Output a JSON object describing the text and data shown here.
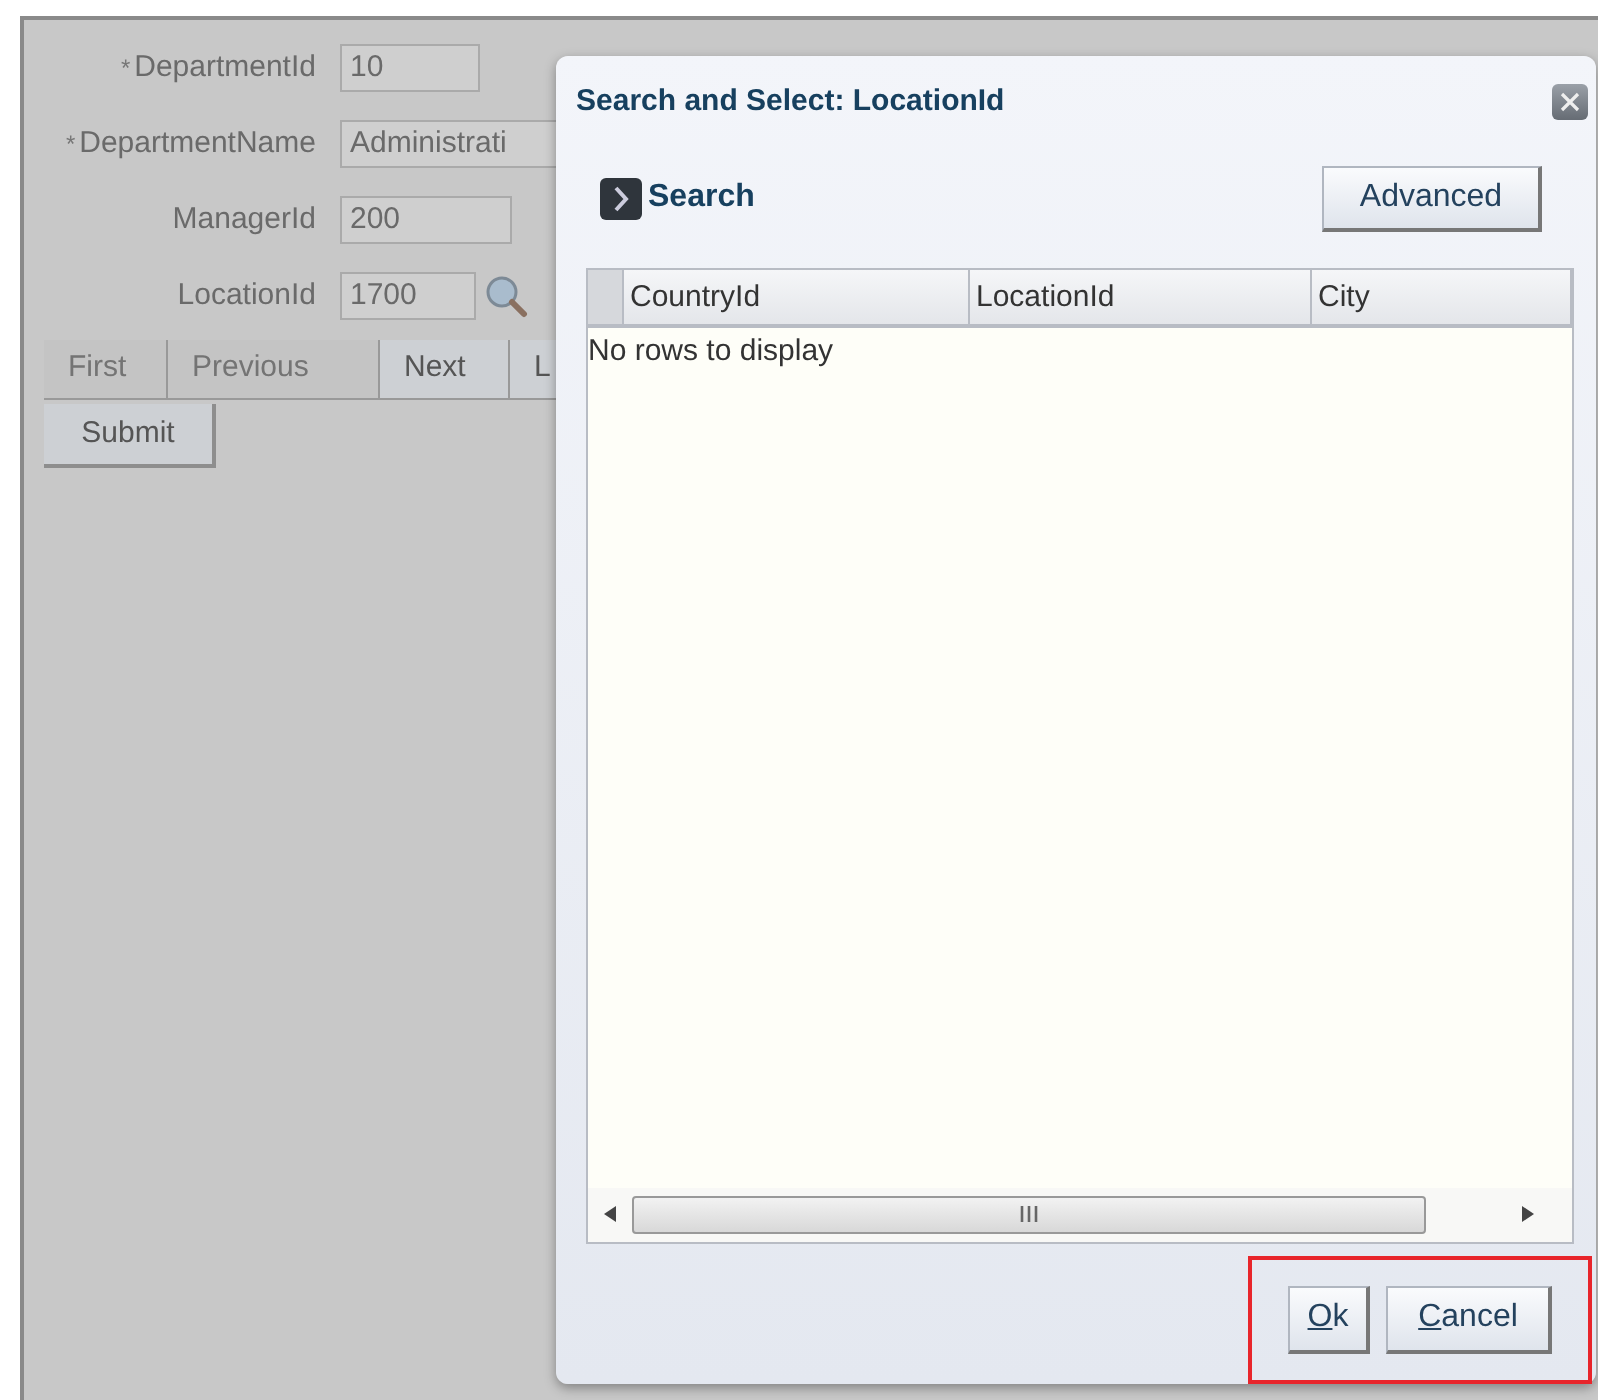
{
  "form": {
    "fields": [
      {
        "kind": "text",
        "label": "DepartmentId",
        "required": true,
        "value": "10"
      },
      {
        "kind": "text",
        "label": "DepartmentName",
        "required": true,
        "value": "Administrati"
      },
      {
        "kind": "text",
        "label": "ManagerId",
        "required": false,
        "value": "200"
      },
      {
        "kind": "lookup",
        "label": "LocationId",
        "required": false,
        "value": "1700"
      }
    ],
    "required_mark": "*",
    "pager": [
      {
        "label": "First",
        "disabled": true
      },
      {
        "label": "Previous",
        "disabled": true
      },
      {
        "label": "Next",
        "disabled": false
      },
      {
        "label": "L",
        "disabled": false
      }
    ],
    "submit": "Submit"
  },
  "dialog": {
    "title": "Search and Select: LocationId",
    "search_label": "Search",
    "advanced_button": "Advanced",
    "table": {
      "columns": [
        "CountryId",
        "LocationId",
        "City"
      ],
      "empty_message": "No rows to display"
    },
    "buttons_highlighted": true,
    "buttons": [
      {
        "access_key": "O",
        "label_rest": "k"
      },
      {
        "access_key": "C",
        "label_rest": "ancel"
      }
    ]
  }
}
